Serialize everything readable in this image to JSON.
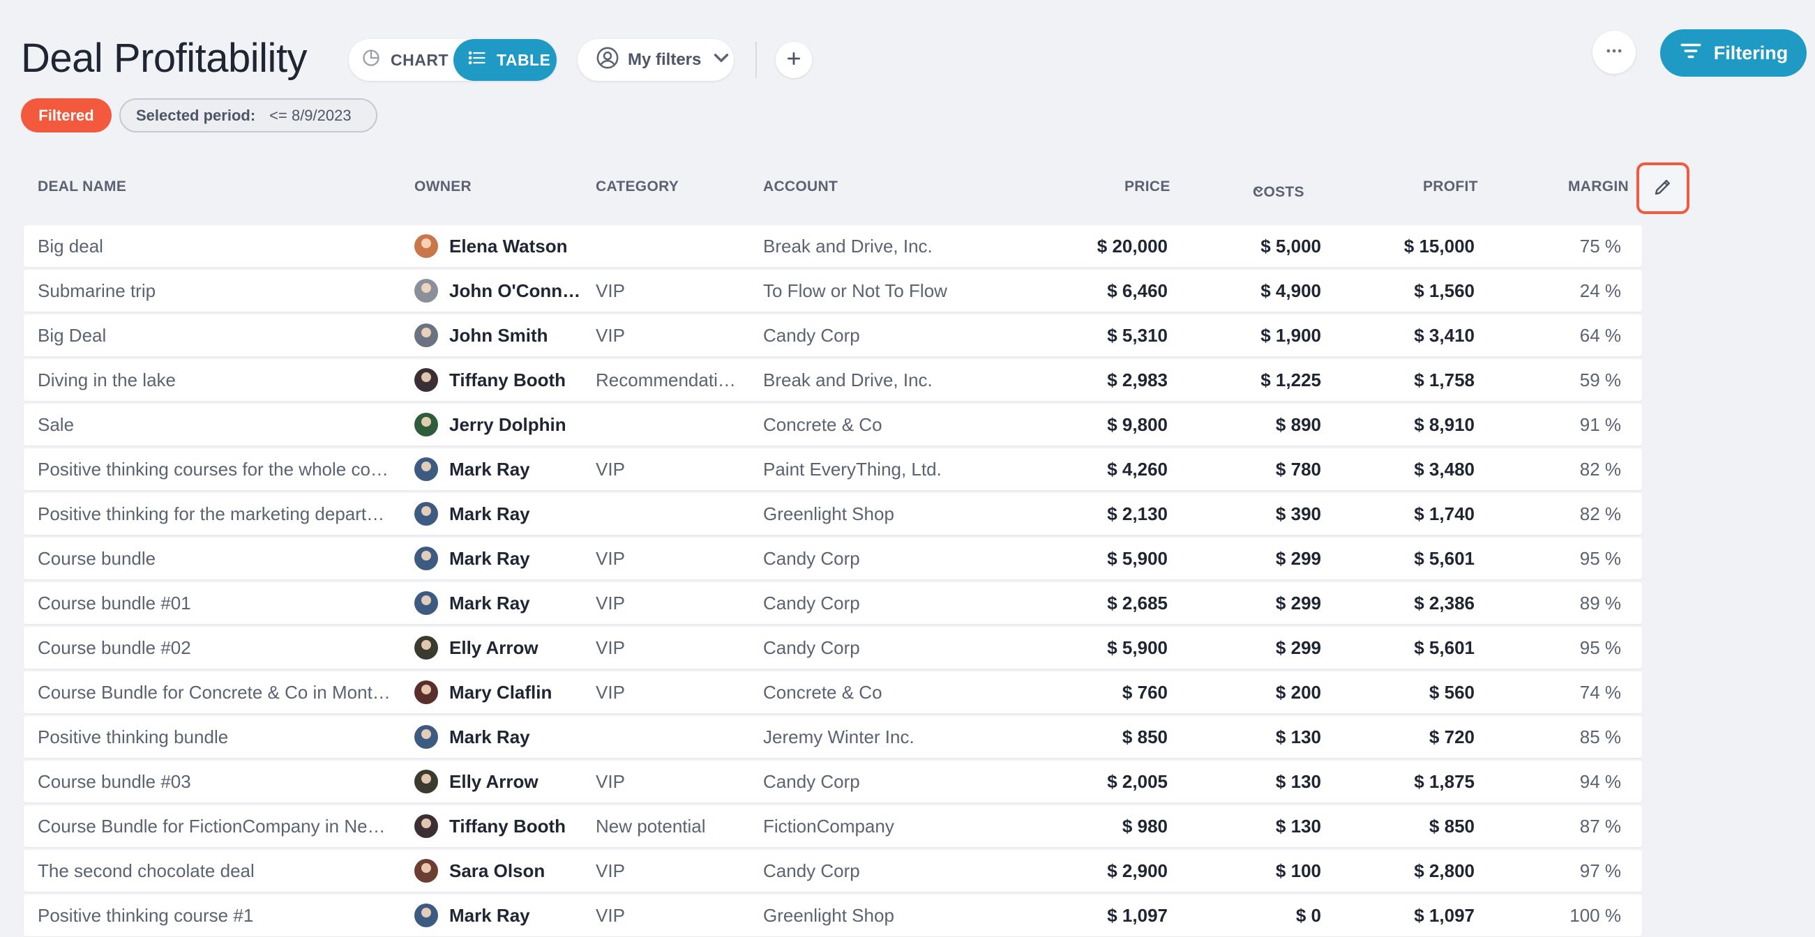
{
  "header": {
    "title": "Deal Profitability",
    "view_toggle": {
      "chart_label": "CHART",
      "table_label": "TABLE",
      "active": "table"
    },
    "my_filters_label": "My filters",
    "filtering_label": "Filtering",
    "accent_color": "#1e9ac4"
  },
  "filters": {
    "status_badge": "Filtered",
    "status_color": "#f2593d",
    "period_label": "Selected period:",
    "period_value": "<= 8/9/2023"
  },
  "table": {
    "columns": {
      "deal_name": "DEAL NAME",
      "owner": "OWNER",
      "category": "CATEGORY",
      "account": "ACCOUNT",
      "price": "PRICE",
      "costs": "COSTS",
      "profit": "PROFIT",
      "margin": "MARGIN"
    },
    "sorted_column": "costs",
    "rows": [
      {
        "deal": "Big deal",
        "owner": "Elena Watson",
        "avatar_color": "#c9774a",
        "category": "",
        "account": "Break and Drive, Inc.",
        "price": "$ 20,000",
        "costs": "$ 5,000",
        "profit": "$ 15,000",
        "margin": "75 %"
      },
      {
        "deal": "Submarine trip",
        "owner": "John O'Conn…",
        "avatar_color": "#8a8f99",
        "category": "VIP",
        "account": "To Flow or Not To Flow",
        "price": "$ 6,460",
        "costs": "$ 4,900",
        "profit": "$ 1,560",
        "margin": "24 %"
      },
      {
        "deal": "Big Deal",
        "owner": "John Smith",
        "avatar_color": "#6b7280",
        "category": "VIP",
        "account": "Candy Corp",
        "price": "$ 5,310",
        "costs": "$ 1,900",
        "profit": "$ 3,410",
        "margin": "64 %"
      },
      {
        "deal": "Diving in the lake",
        "owner": "Tiffany Booth",
        "avatar_color": "#3b2f35",
        "category": "Recommendati…",
        "account": "Break and Drive, Inc.",
        "price": "$ 2,983",
        "costs": "$ 1,225",
        "profit": "$ 1,758",
        "margin": "59 %"
      },
      {
        "deal": "Sale",
        "owner": "Jerry Dolphin",
        "avatar_color": "#2f5d3a",
        "category": "",
        "account": "Concrete & Co",
        "price": "$ 9,800",
        "costs": "$ 890",
        "profit": "$ 8,910",
        "margin": "91 %"
      },
      {
        "deal": "Positive thinking courses for the whole co…",
        "owner": "Mark Ray",
        "avatar_color": "#3d5a80",
        "category": "VIP",
        "account": "Paint EveryThing, Ltd.",
        "price": "$ 4,260",
        "costs": "$ 780",
        "profit": "$ 3,480",
        "margin": "82 %"
      },
      {
        "deal": "Positive thinking for the marketing depart…",
        "owner": "Mark Ray",
        "avatar_color": "#3d5a80",
        "category": "",
        "account": "Greenlight Shop",
        "price": "$ 2,130",
        "costs": "$ 390",
        "profit": "$ 1,740",
        "margin": "82 %"
      },
      {
        "deal": "Course bundle",
        "owner": "Mark Ray",
        "avatar_color": "#3d5a80",
        "category": "VIP",
        "account": "Candy Corp",
        "price": "$ 5,900",
        "costs": "$ 299",
        "profit": "$ 5,601",
        "margin": "95 %"
      },
      {
        "deal": "Course bundle #01",
        "owner": "Mark Ray",
        "avatar_color": "#3d5a80",
        "category": "VIP",
        "account": "Candy Corp",
        "price": "$ 2,685",
        "costs": "$ 299",
        "profit": "$ 2,386",
        "margin": "89 %"
      },
      {
        "deal": "Course bundle #02",
        "owner": "Elly Arrow",
        "avatar_color": "#3a3a2e",
        "category": "VIP",
        "account": "Candy Corp",
        "price": "$ 5,900",
        "costs": "$ 299",
        "profit": "$ 5,601",
        "margin": "95 %"
      },
      {
        "deal": "Course Bundle for Concrete & Co in Mont…",
        "owner": "Mary Claflin",
        "avatar_color": "#5a2e2a",
        "category": "VIP",
        "account": "Concrete & Co",
        "price": "$ 760",
        "costs": "$ 200",
        "profit": "$ 560",
        "margin": "74 %"
      },
      {
        "deal": "Positive thinking bundle",
        "owner": "Mark Ray",
        "avatar_color": "#3d5a80",
        "category": "",
        "account": "Jeremy Winter Inc.",
        "price": "$ 850",
        "costs": "$ 130",
        "profit": "$ 720",
        "margin": "85 %"
      },
      {
        "deal": "Course bundle #03",
        "owner": "Elly Arrow",
        "avatar_color": "#3a3a2e",
        "category": "VIP",
        "account": "Candy Corp",
        "price": "$ 2,005",
        "costs": "$ 130",
        "profit": "$ 1,875",
        "margin": "94 %"
      },
      {
        "deal": "Course Bundle for FictionCompany in Ne…",
        "owner": "Tiffany Booth",
        "avatar_color": "#3b2f35",
        "category": "New potential",
        "account": "FictionCompany",
        "price": "$ 980",
        "costs": "$ 130",
        "profit": "$ 850",
        "margin": "87 %"
      },
      {
        "deal": "The second chocolate deal",
        "owner": "Sara Olson",
        "avatar_color": "#6b3d33",
        "category": "VIP",
        "account": "Candy Corp",
        "price": "$ 2,900",
        "costs": "$ 100",
        "profit": "$ 2,800",
        "margin": "97 %"
      },
      {
        "deal": "Positive thinking course #1",
        "owner": "Mark Ray",
        "avatar_color": "#3d5a80",
        "category": "VIP",
        "account": "Greenlight Shop",
        "price": "$ 1,097",
        "costs": "$ 0",
        "profit": "$ 1,097",
        "margin": "100 %"
      }
    ]
  }
}
